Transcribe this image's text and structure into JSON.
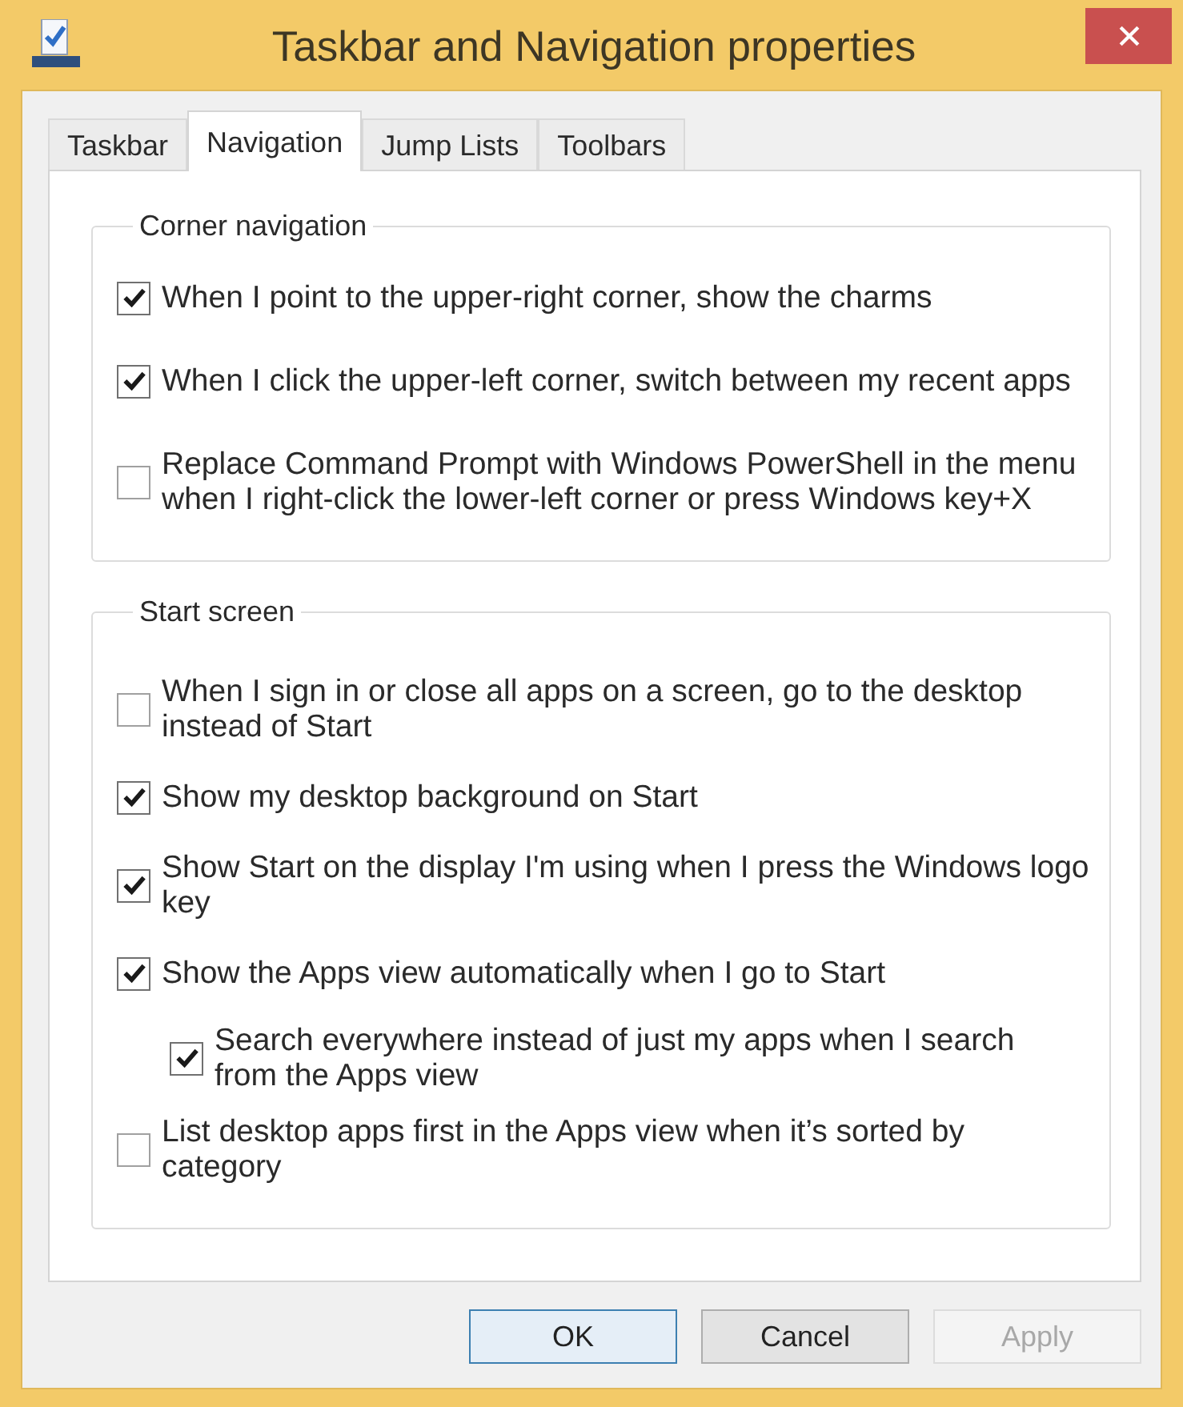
{
  "window": {
    "title": "Taskbar and Navigation properties"
  },
  "tabs": [
    {
      "label": "Taskbar",
      "selected": false
    },
    {
      "label": "Navigation",
      "selected": true
    },
    {
      "label": "Jump Lists",
      "selected": false
    },
    {
      "label": "Toolbars",
      "selected": false
    }
  ],
  "groups": [
    {
      "title": "Corner navigation",
      "options": [
        {
          "label": "When I point to the upper-right corner, show the charms",
          "checked": true
        },
        {
          "label": "When I click the upper-left corner, switch between my recent apps",
          "checked": true
        },
        {
          "label": "Replace Command Prompt with Windows PowerShell in the menu when I right-click the lower-left corner or press Windows key+X",
          "checked": false
        }
      ]
    },
    {
      "title": "Start screen",
      "options": [
        {
          "label": "When I sign in or close all apps on a screen, go to the desktop instead of Start",
          "checked": false
        },
        {
          "label": "Show my desktop background on Start",
          "checked": true
        },
        {
          "label": "Show Start on the display I'm using when I press the Windows logo key",
          "checked": true
        },
        {
          "label": "Show the Apps view automatically when I go to Start",
          "checked": true,
          "children": [
            {
              "label": "Search everywhere instead of just my apps when I search from the Apps view",
              "checked": true
            }
          ]
        },
        {
          "label": "List desktop apps first in the Apps view when it’s sorted by category",
          "checked": false
        }
      ]
    }
  ],
  "buttons": [
    {
      "label": "OK",
      "kind": "default",
      "disabled": false
    },
    {
      "label": "Cancel",
      "kind": "normal",
      "disabled": false
    },
    {
      "label": "Apply",
      "kind": "normal",
      "disabled": true
    }
  ]
}
